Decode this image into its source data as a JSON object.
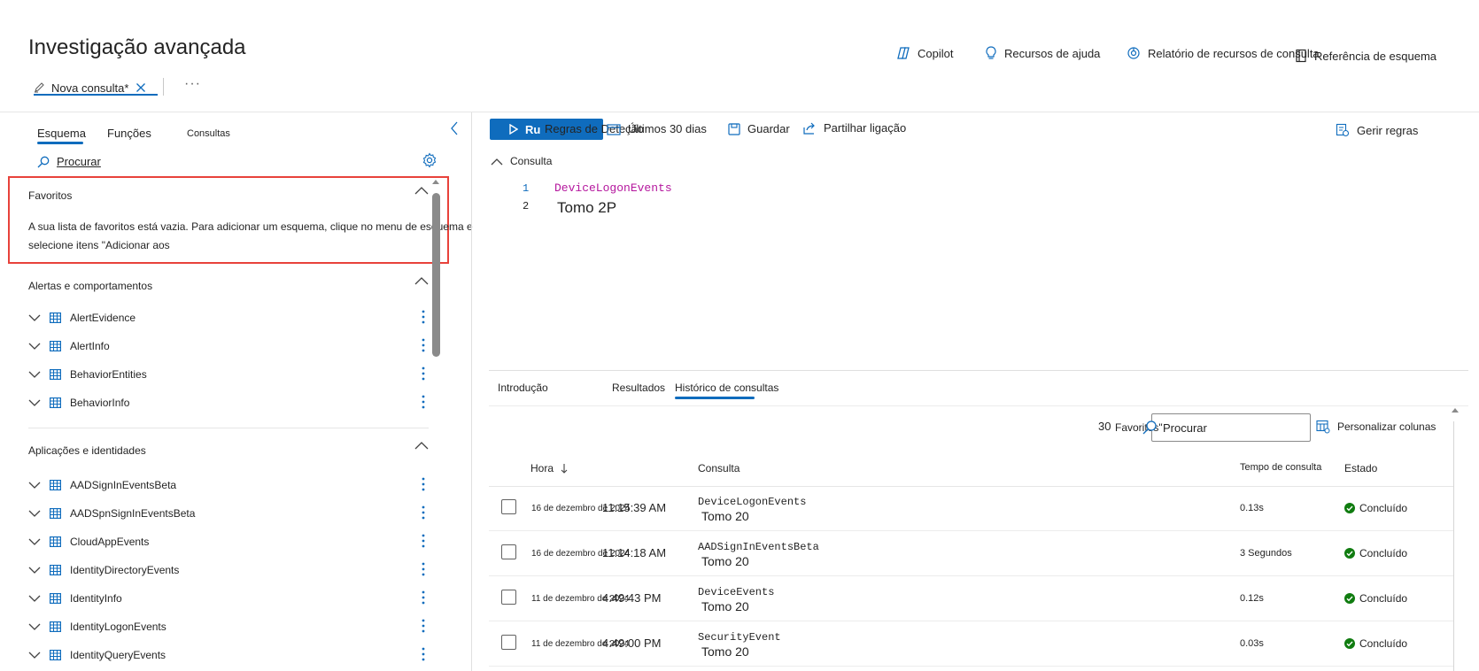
{
  "page": {
    "title": "Investigação avançada"
  },
  "top_actions": {
    "copilot": "Copilot",
    "help": "Recursos de ajuda",
    "report": "Relatório de recursos de consulta",
    "schema_ref": "Referência de esquema"
  },
  "query_tab": {
    "label": "Nova consulta*",
    "more": "···"
  },
  "left": {
    "tabs": {
      "schema": "Esquema",
      "functions": "Funções",
      "queries": "Consultas"
    },
    "search": "Procurar",
    "favorites": {
      "title": "Favoritos",
      "empty_text": "A sua lista de favoritos está vazia. Para adicionar um esquema, clique no menu de esquema e selecione itens \"Adicionar aos"
    },
    "alerts": {
      "title": "Alertas e comportamentos",
      "items": [
        "AlertEvidence",
        "AlertInfo",
        "BehaviorEntities",
        "BehaviorInfo"
      ]
    },
    "apps": {
      "title": "Aplicações e identidades",
      "items": [
        "AADSignInEventsBeta",
        "AADSpnSignInEventsBeta",
        "CloudAppEvents",
        "IdentityDirectoryEvents",
        "IdentityInfo",
        "IdentityLogonEvents",
        "IdentityQueryEvents"
      ]
    }
  },
  "toolbar": {
    "run": "Ru",
    "detection_rule": "Regras de Deteção",
    "time_range": "Últimos 30 dias",
    "save": "Guardar",
    "share": "Partilhar ligação",
    "manage_rules": "Gerir regras"
  },
  "editor": {
    "section_label": "Consulta",
    "lines": [
      {
        "num": "1",
        "text": "DeviceLogonEvents"
      },
      {
        "num": "2",
        "text": "Tomo 2P"
      }
    ]
  },
  "results_tabs": {
    "intro": "Introdução",
    "results": "Resultados",
    "history": "Histórico de consultas"
  },
  "history": {
    "favorites_count": "30",
    "favorites_label": "Favoritos\"",
    "search_placeholder": "Procurar",
    "customize_columns": "Personalizar colunas",
    "columns": {
      "time": "Hora",
      "query": "Consulta",
      "duration": "Tempo de consulta",
      "state": "Estado"
    },
    "rows": [
      {
        "date": "16 de dezembro de 2024",
        "time": "11:15:39 AM",
        "query": "DeviceLogonEvents",
        "sub": "Tomo 20",
        "duration": "0.13s",
        "state": "Concluído"
      },
      {
        "date": "16 de dezembro de 2024",
        "time": "11:14:18 AM",
        "query": "AADSignInEventsBeta",
        "sub": "Tomo 20",
        "duration": "3 Segundos",
        "state": "Concluído"
      },
      {
        "date": "11 de dezembro de 2024",
        "time": "4:49:43 PM",
        "query": "DeviceEvents",
        "sub": "Tomo 20",
        "duration": "0.12s",
        "state": "Concluído"
      },
      {
        "date": "11 de dezembro de 2024",
        "time": "4:49:00 PM",
        "query": "SecurityEvent",
        "sub": "Tomo 20",
        "duration": "0.03s",
        "state": "Concluído"
      }
    ]
  },
  "colors": {
    "accent": "#0f6cbd",
    "highlight_border": "#e8423b",
    "success": "#107c10",
    "code_keyword": "#b5179e"
  }
}
